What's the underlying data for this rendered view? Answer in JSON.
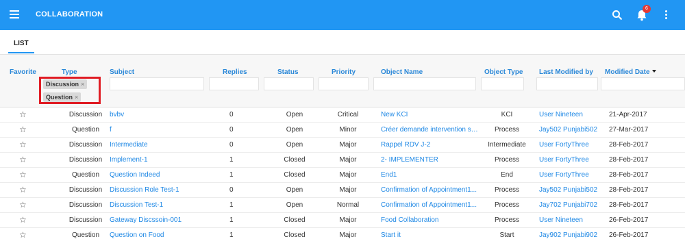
{
  "app": {
    "title": "COLLABORATION",
    "notification_count": "6"
  },
  "tabs": [
    {
      "label": "LIST"
    }
  ],
  "columns": {
    "favorite": "Favorite",
    "type": "Type",
    "subject": "Subject",
    "replies": "Replies",
    "status": "Status",
    "priority": "Priority",
    "object_name": "Object Name",
    "object_type": "Object Type",
    "last_modified_by": "Last Modified by",
    "modified_date": "Modified Date"
  },
  "type_filter_chips": [
    {
      "label": "Discussion",
      "remove": "×"
    },
    {
      "label": "Question",
      "remove": "×"
    }
  ],
  "sort": {
    "column": "modified_date",
    "direction": "descending"
  },
  "rows": [
    {
      "favorite": "☆",
      "type": "Discussion",
      "subject": "bvbv",
      "replies": "0",
      "status": "Open",
      "priority": "Critical",
      "object_name": "New KCI",
      "object_type": "KCI",
      "last_modified_by": "User Nineteen",
      "modified_date": "21-Apr-2017"
    },
    {
      "favorite": "☆",
      "type": "Question",
      "subject": "f",
      "replies": "0",
      "status": "Open",
      "priority": "Minor",
      "object_name": "Créer demande intervention se...",
      "object_type": "Process",
      "last_modified_by": "Jay502 Punjabi502",
      "modified_date": "27-Mar-2017"
    },
    {
      "favorite": "☆",
      "type": "Discussion",
      "subject": "Intermediate",
      "replies": "0",
      "status": "Open",
      "priority": "Major",
      "object_name": "Rappel RDV J-2",
      "object_type": "Intermediate",
      "last_modified_by": "User FortyThree",
      "modified_date": "28-Feb-2017"
    },
    {
      "favorite": "☆",
      "type": "Discussion",
      "subject": "Implement-1",
      "replies": "1",
      "status": "Closed",
      "priority": "Major",
      "object_name": "2- IMPLEMENTER",
      "object_type": "Process",
      "last_modified_by": "User FortyThree",
      "modified_date": "28-Feb-2017"
    },
    {
      "favorite": "☆",
      "type": "Question",
      "subject": "Question Indeed",
      "replies": "1",
      "status": "Closed",
      "priority": "Major",
      "object_name": "End1",
      "object_type": "End",
      "last_modified_by": "User FortyThree",
      "modified_date": "28-Feb-2017"
    },
    {
      "favorite": "☆",
      "type": "Discussion",
      "subject": "Discussion Role Test-1",
      "replies": "0",
      "status": "Open",
      "priority": "Major",
      "object_name": "Confirmation of Appointment1...",
      "object_type": "Process",
      "last_modified_by": "Jay502 Punjabi502",
      "modified_date": "28-Feb-2017"
    },
    {
      "favorite": "☆",
      "type": "Discussion",
      "subject": "Discussion Test-1",
      "replies": "1",
      "status": "Open",
      "priority": "Normal",
      "object_name": "Confirmation of Appointment1...",
      "object_type": "Process",
      "last_modified_by": "Jay702 Punjabi702",
      "modified_date": "28-Feb-2017"
    },
    {
      "favorite": "☆",
      "type": "Discussion",
      "subject": "Gateway Discssoin-001",
      "replies": "1",
      "status": "Closed",
      "priority": "Major",
      "object_name": "Food Collaboration",
      "object_type": "Process",
      "last_modified_by": "User Nineteen",
      "modified_date": "26-Feb-2017"
    },
    {
      "favorite": "☆",
      "type": "Question",
      "subject": "Question on Food",
      "replies": "1",
      "status": "Closed",
      "priority": "Major",
      "object_name": "Start it",
      "object_type": "Start",
      "last_modified_by": "Jay902 Punjabi902",
      "modified_date": "26-Feb-2017"
    }
  ],
  "colors": {
    "topbar": "#2196f3",
    "link": "#1e88e5",
    "header_text": "#2b88d8",
    "highlight": "#e01c24",
    "badge": "#e53935"
  },
  "icons": [
    "menu-icon",
    "search-icon",
    "bell-icon",
    "more-vert-icon",
    "star-outline-icon",
    "sort-desc-icon",
    "chip-remove-icon"
  ]
}
